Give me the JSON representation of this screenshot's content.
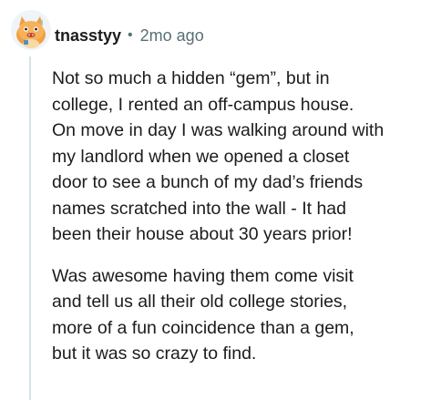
{
  "comment": {
    "username": "tnasstyy",
    "separator": "•",
    "timestamp": "2mo ago",
    "avatar_icon": "snorlax-avatar-icon",
    "paragraphs": [
      {
        "lines": [
          "Not so much a hidden “gem”, but in",
          "college, I rented an off-campus house.",
          "On move in day I was walking around with",
          "my landlord when we opened a closet",
          "door to see a bunch of my dad’s friends",
          "names scratched into the wall - It had",
          "been their house about 30 years prior!"
        ]
      },
      {
        "lines": [
          "Was awesome having them come visit",
          "and tell us all their old college stories,",
          "more of a fun coincidence than a gem,",
          "but it was so crazy to find."
        ]
      }
    ]
  },
  "colors": {
    "text": "#1c1c1c",
    "meta": "#576f76",
    "thread_line": "#d5e4ea",
    "avatar_bg": "#eef4f7",
    "avatar_character": "#f0a040"
  }
}
